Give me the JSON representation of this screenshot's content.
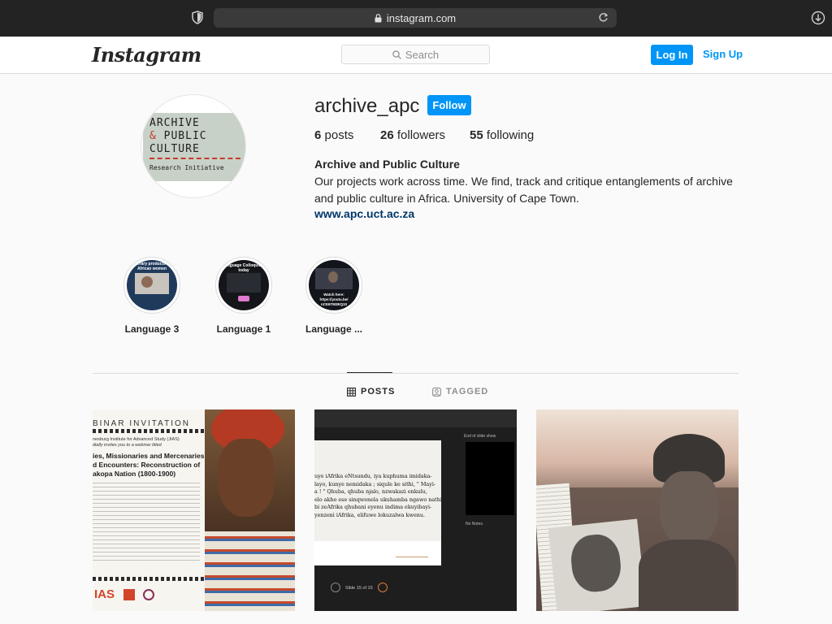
{
  "browser": {
    "url": "instagram.com"
  },
  "header": {
    "logo": "Instagram",
    "search_placeholder": "Search",
    "login_label": "Log In",
    "signup_label": "Sign Up"
  },
  "profile": {
    "username": "archive_apc",
    "follow_label": "Follow",
    "avatar_text": {
      "line1": "ARCHIVE",
      "amp": "&",
      "line2": "PUBLIC",
      "line3": "CULTURE",
      "sub": "Research Initiative"
    },
    "stats": {
      "posts_count": "6",
      "posts_label": "posts",
      "followers_count": "26",
      "followers_label": "followers",
      "following_count": "55",
      "following_label": "following"
    },
    "bio_name": "Archive and Public Culture",
    "bio_text": "Our projects work across time. We find, track and critique entanglements of archive and public culture in Africa. University of Cape Town.",
    "bio_link": "www.apc.uct.ac.za"
  },
  "highlights": [
    {
      "label": "Language 3",
      "overlay": "Literary products by African women"
    },
    {
      "label": "Language 1",
      "overlay": "Language Colloquium today"
    },
    {
      "label": "Language ...",
      "overlay": "Watch here: https://youtu.be/ nCE6TM3EQ10"
    }
  ],
  "tabs": {
    "posts": "POSTS",
    "tagged": "TAGGED"
  },
  "posts": [
    {
      "banner": "BINAR INVITATION",
      "lines": [
        "nesburg Institute for Advanced Study (JIAS)",
        "dially invites you to a webinar titled"
      ],
      "title": "ies, Missionaries and Mercenaries\nd Encounters: Reconstruction of\nakopa Nation (1800-1900)",
      "logo": "IAS"
    },
    {
      "slide_text": "uye iAfrika eNtsundu, iya kuphuma imidaka-\nlayo, kunye nemidaka ; siqule ke sithi, \" Mayi-\na ! \" Qhuba, qhuba njalo, nzwakazi enkulu,\nelo akho ese sinqwenela ukuhamba ngawo nathi.\nbi zeAfrika qhubani eyenu indima ekuyibayi-\nyenzeni iAfrika, elifuwe lokuzalwa kwenu.",
      "end_label": "End of slide show",
      "notes_label": "No Notes.",
      "slide_counter": "Slide 15 of 15"
    },
    {
      "desc": "photo"
    }
  ],
  "colors": {
    "accent": "#0095f6",
    "link": "#00376b",
    "text": "#262626",
    "muted": "#8e8e8e"
  }
}
